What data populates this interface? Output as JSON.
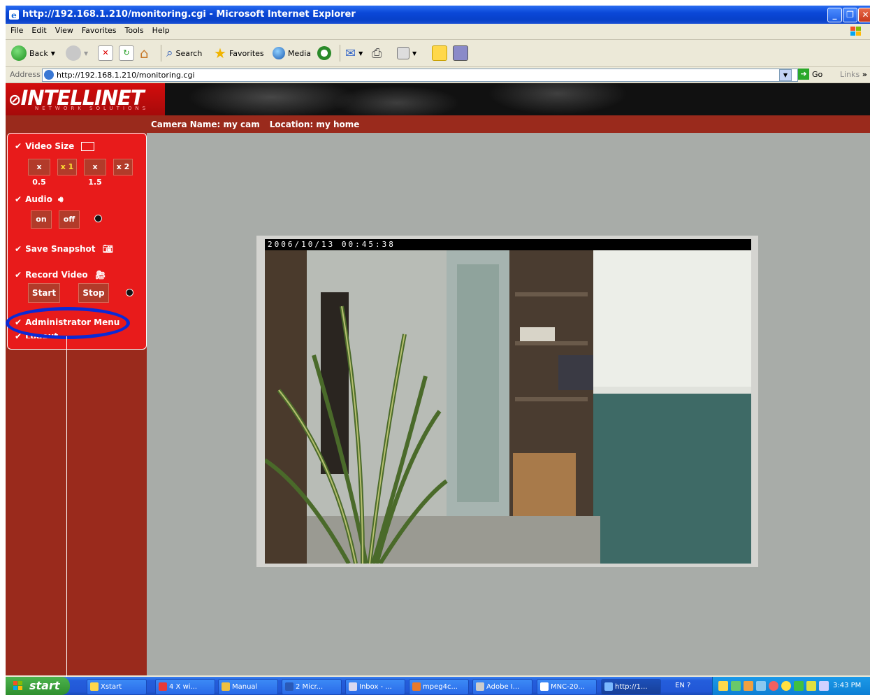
{
  "window": {
    "title": "http://192.168.1.210/monitoring.cgi - Microsoft Internet Explorer"
  },
  "menu": [
    "File",
    "Edit",
    "View",
    "Favorites",
    "Tools",
    "Help"
  ],
  "toolbar": {
    "back": "Back",
    "search": "Search",
    "favorites": "Favorites",
    "media": "Media"
  },
  "address": {
    "label": "Address",
    "url": "http://192.168.1.210/monitoring.cgi",
    "go": "Go",
    "links": "Links"
  },
  "page": {
    "logo": "INTELLINET",
    "logo_sub": "NETWORK SOLUTIONS",
    "camera_name": "Camera Name: my cam",
    "location": "Location: my home",
    "video_size": {
      "label": "Video Size",
      "options": [
        "x 0.5",
        "x 1",
        "x 1.5",
        "x 2"
      ],
      "selected": "x 1"
    },
    "audio": {
      "label": "Audio",
      "on": "on",
      "off": "off"
    },
    "save_snapshot": "Save Snapshot",
    "record_video": {
      "label": "Record Video",
      "start": "Start",
      "stop": "Stop"
    },
    "admin_menu": "Administrator Menu",
    "logout": "Logout",
    "timestamp": "2006/10/13  00:45:38"
  },
  "taskbar": {
    "start": "start",
    "items": [
      "Xstart",
      "4 X wi...",
      "Manual",
      "2 Micr...",
      "Inbox - ...",
      "mpeg4c...",
      "Adobe I...",
      "MNC-20...",
      "http://1..."
    ],
    "lang": "EN",
    "clock": "3:43 PM"
  },
  "colors": {
    "brand_red": "#e81b1b",
    "dark_red": "#9a2a1c",
    "highlight_ellipse": "#0a2ad6"
  }
}
